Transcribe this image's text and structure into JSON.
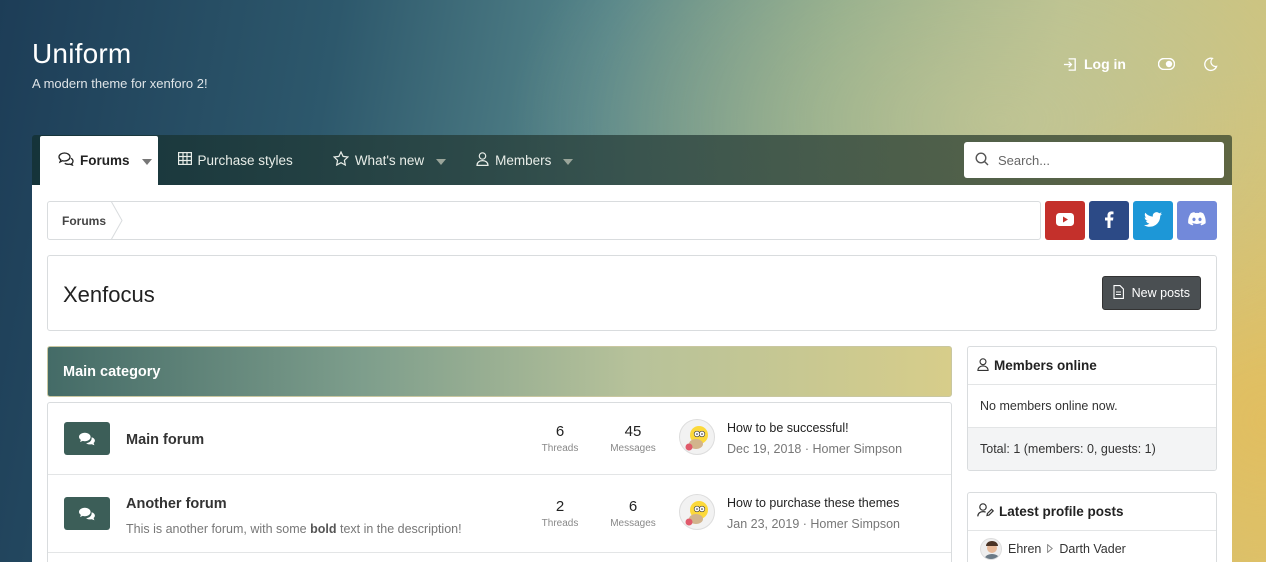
{
  "site": {
    "title": "Uniform",
    "tagline": "A modern theme for xenforo 2!"
  },
  "top_actions": {
    "login_label": "Log in"
  },
  "nav": {
    "tabs": [
      {
        "label": "Forums"
      },
      {
        "label": "Purchase styles"
      },
      {
        "label": "What's new"
      },
      {
        "label": "Members"
      }
    ],
    "search_placeholder": "Search..."
  },
  "breadcrumb": {
    "items": [
      "Forums"
    ]
  },
  "social": {
    "colors": {
      "youtube": "#c4302b",
      "facebook": "#2c4a86",
      "twitter": "#1d97d7",
      "discord": "#7289da"
    }
  },
  "page": {
    "title": "Xenfocus",
    "new_posts_label": "New posts"
  },
  "category": {
    "title": "Main category"
  },
  "forums": [
    {
      "name": "Main forum",
      "description": "",
      "threads": "6",
      "threads_label": "Threads",
      "messages": "45",
      "messages_label": "Messages",
      "latest_title": "How to be successful!",
      "latest_meta": "Dec 19, 2018 · Homer Simpson"
    },
    {
      "name": "Another forum",
      "description_pre": "This is another forum, with some ",
      "description_bold": "bold",
      "description_post": " text in the description!",
      "threads": "2",
      "threads_label": "Threads",
      "messages": "6",
      "messages_label": "Messages",
      "latest_title": "How to purchase these themes",
      "latest_meta": "Jan 23, 2019 · Homer Simpson"
    }
  ],
  "sidebar": {
    "members_online": {
      "title": "Members online",
      "body": "No members online now.",
      "total": "Total: 1 (members: 0, guests: 1)"
    },
    "latest_profile_posts": {
      "title": "Latest profile posts",
      "first_from": "Ehren",
      "first_to": "Darth Vader"
    }
  }
}
